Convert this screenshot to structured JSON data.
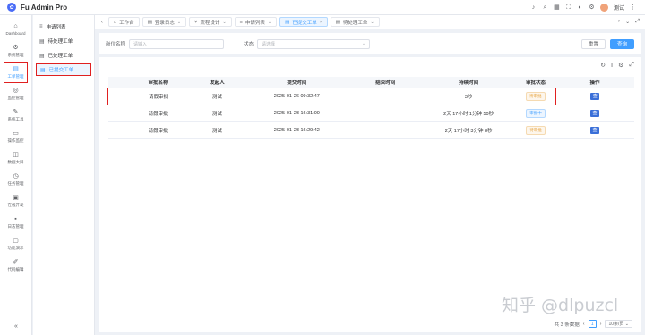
{
  "app": {
    "title": "Fu Admin Pro"
  },
  "topbar": {
    "username": "测试"
  },
  "rail": {
    "items": [
      {
        "label": "Dashboard",
        "icon": "home-icon"
      },
      {
        "label": "系统管理",
        "icon": "gear-icon"
      },
      {
        "label": "工单管理",
        "icon": "document-icon"
      },
      {
        "label": "监控管理",
        "icon": "monitor-icon"
      },
      {
        "label": "系统工具",
        "icon": "tools-icon"
      },
      {
        "label": "操作监控",
        "icon": "screen-icon"
      },
      {
        "label": "数据大屏",
        "icon": "chart-icon"
      },
      {
        "label": "任务管理",
        "icon": "clock-icon"
      },
      {
        "label": "在线开发",
        "icon": "code-icon"
      },
      {
        "label": "日志管理",
        "icon": "log-icon"
      },
      {
        "label": "功能演示",
        "icon": "display-icon"
      },
      {
        "label": "代码编辑",
        "icon": "edit-icon"
      }
    ]
  },
  "submenu": {
    "items": [
      {
        "label": "申请列表"
      },
      {
        "label": "待处理工单"
      },
      {
        "label": "已处理工单"
      },
      {
        "label": "已提交工单"
      }
    ]
  },
  "tabs": [
    {
      "label": "工作台"
    },
    {
      "label": "登录日志"
    },
    {
      "label": "流程设计"
    },
    {
      "label": "申请列表"
    },
    {
      "label": "已提交工单"
    },
    {
      "label": "待处理工单"
    }
  ],
  "search": {
    "name_label": "岗位名称",
    "name_placeholder": "请输入",
    "status_label": "状态",
    "status_placeholder": "请选择",
    "reset_label": "重置",
    "query_label": "查询"
  },
  "table": {
    "columns": [
      "审批名称",
      "发起人",
      "提交时间",
      "结束时间",
      "持续时间",
      "审批状态",
      "操作"
    ],
    "rows": [
      {
        "name": "请假审批",
        "initiator": "测试",
        "submit_time": "2025-01-26 09:32:47",
        "end_time": "",
        "duration": "3秒",
        "status": "待审批",
        "status_type": "warn",
        "op": "查"
      },
      {
        "name": "请假审批",
        "initiator": "测试",
        "submit_time": "2025-01-23 16:31:00",
        "end_time": "",
        "duration": "2天 17小时 1分钟 50秒",
        "status": "审批中",
        "status_type": "info",
        "op": "查"
      },
      {
        "name": "请假审批",
        "initiator": "测试",
        "submit_time": "2025-01-23 16:29:42",
        "end_time": "",
        "duration": "2天 17小时 3分钟 8秒",
        "status": "待审批",
        "status_type": "warn",
        "op": "查"
      }
    ]
  },
  "pagination": {
    "total_text": "共 3 条数据",
    "current_page": "1",
    "page_size": "10条/页"
  },
  "watermark": "知乎 @dlpuzcl",
  "colors": {
    "primary": "#409eff",
    "highlight": "#e02020",
    "warning": "#e6a23c"
  }
}
